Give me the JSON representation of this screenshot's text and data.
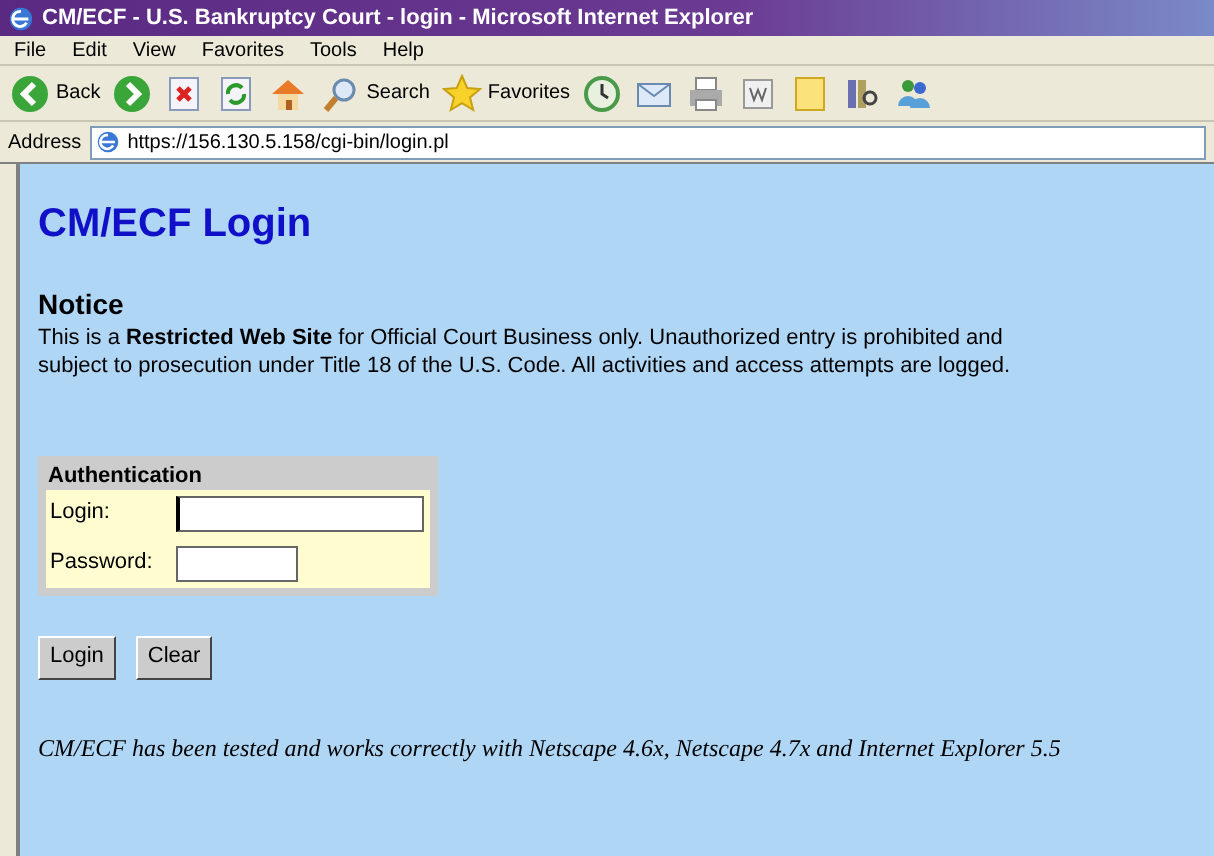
{
  "window": {
    "title": "CM/ECF - U.S. Bankruptcy Court - login - Microsoft Internet Explorer"
  },
  "menu": [
    "File",
    "Edit",
    "View",
    "Favorites",
    "Tools",
    "Help"
  ],
  "toolbar": [
    {
      "kind": "back",
      "label": "Back"
    },
    {
      "kind": "forward"
    },
    {
      "kind": "stop"
    },
    {
      "kind": "refresh"
    },
    {
      "kind": "home"
    },
    {
      "kind": "search",
      "label": "Search"
    },
    {
      "kind": "favorites",
      "label": "Favorites"
    },
    {
      "kind": "history"
    },
    {
      "kind": "mail"
    },
    {
      "kind": "print"
    },
    {
      "kind": "edit"
    },
    {
      "kind": "notes"
    },
    {
      "kind": "research"
    },
    {
      "kind": "messenger"
    }
  ],
  "address_bar": {
    "label": "Address",
    "url": "https://156.130.5.158/cgi-bin/login.pl"
  },
  "page": {
    "heading": "CM/ECF Login",
    "notice_title": "Notice",
    "notice_text": "This is a **Restricted Web Site** for Official Court Business only. Unauthorized entry is prohibited and subject to prosecution under Title 18 of the U.S. Code. All activities and access attempts are logged.",
    "auth_title": "Authentication",
    "fields": [
      {
        "label": "Login:",
        "kind": "text",
        "focused": true
      },
      {
        "label": "Password:",
        "kind": "password",
        "focused": false
      }
    ],
    "buttons": [
      "Login",
      "Clear"
    ],
    "footer": "CM/ECF has been tested and works correctly with Netscape 4.6x, Netscape 4.7x and Internet Explorer 5.5"
  }
}
